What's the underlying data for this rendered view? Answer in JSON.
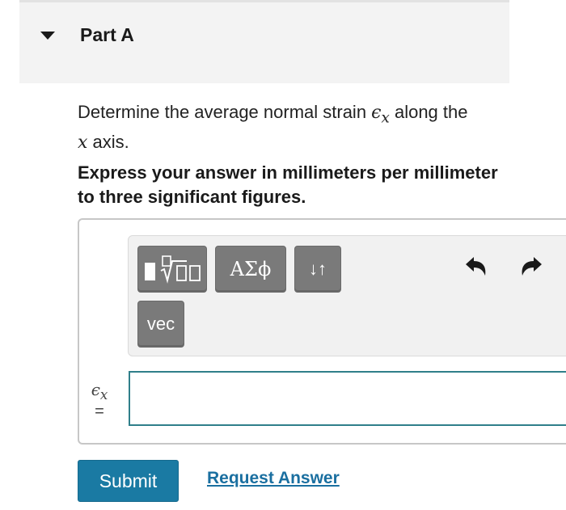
{
  "part": {
    "title": "Part A"
  },
  "question": {
    "text_before": "Determine the average normal strain ",
    "symbol": "ϵ",
    "subscript": "x",
    "text_after": " along the",
    "axis_var": "x",
    "line2_after": " axis."
  },
  "instruction": "Express your answer in millimeters per millimeter to three significant figures.",
  "toolbar": {
    "symbols_label": "ΑΣϕ",
    "arrows_label": "↓↑",
    "vec_label": "vec",
    "icons": [
      "templates-icon",
      "undo-icon",
      "redo-icon"
    ]
  },
  "answer": {
    "variable_symbol": "ϵ",
    "variable_subscript": "x",
    "equals": "=",
    "value": ""
  },
  "actions": {
    "submit_label": "Submit",
    "request_label": "Request Answer"
  },
  "colors": {
    "accent": "#1a7aa3",
    "input_border": "#2f7f8a",
    "toolbar_button": "#7a7a7a"
  }
}
